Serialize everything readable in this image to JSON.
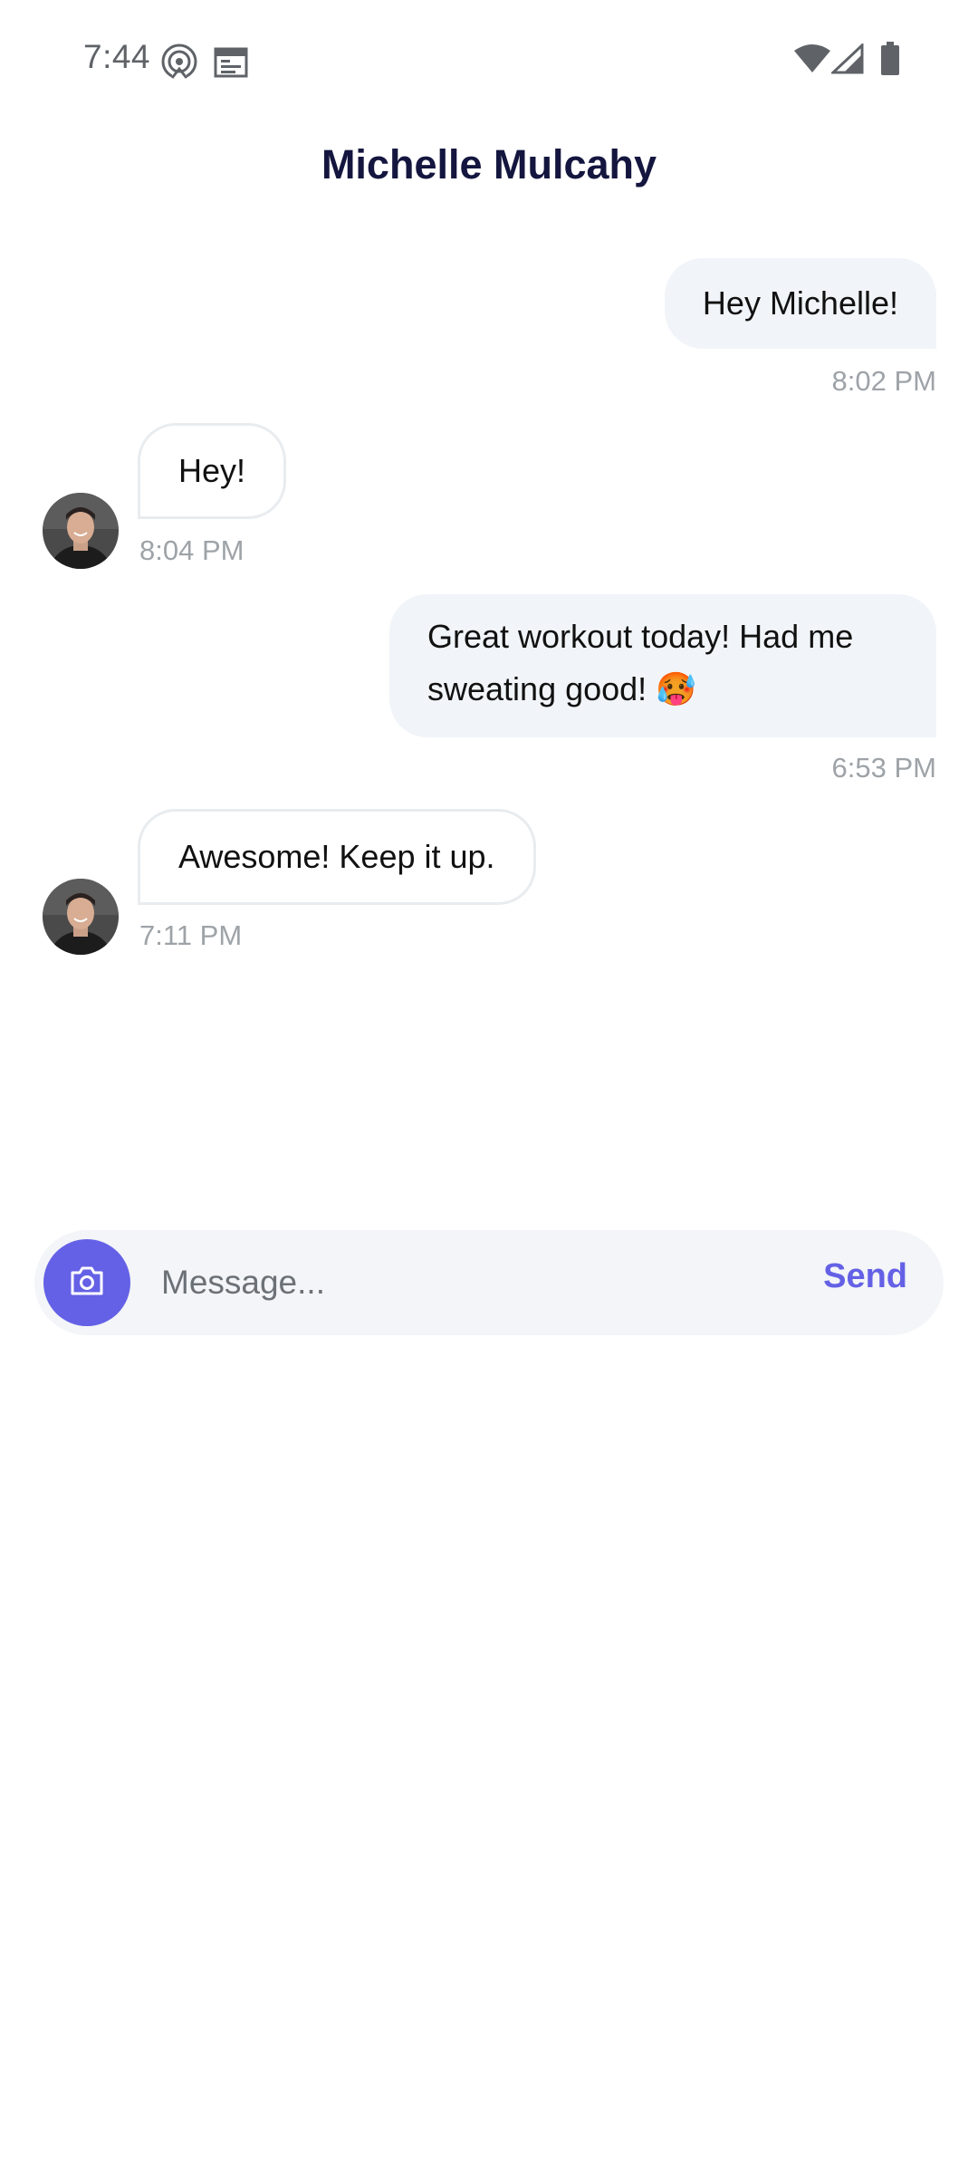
{
  "status_bar": {
    "time": "7:44",
    "left_icons": [
      "podcast-icon",
      "calendar-icon"
    ],
    "right_icons": [
      "wifi-icon",
      "signal-icon",
      "battery-icon"
    ]
  },
  "header": {
    "title": "Michelle Mulcahy"
  },
  "messages": [
    {
      "direction": "outgoing",
      "text": "Hey Michelle!",
      "time": "8:02 PM"
    },
    {
      "direction": "incoming",
      "text": "Hey!",
      "time": "8:04 PM",
      "avatar": "contact-avatar"
    },
    {
      "direction": "outgoing",
      "lines": [
        "Great workout today! Had me",
        "sweating good! 🥵"
      ],
      "time": "6:53 PM"
    },
    {
      "direction": "incoming",
      "text": "Awesome! Keep it up.",
      "time": "7:11 PM",
      "avatar": "contact-avatar"
    }
  ],
  "composer": {
    "placeholder": "Message...",
    "value": "",
    "send_label": "Send",
    "camera_icon": "camera-icon"
  },
  "colors": {
    "accent": "#6461e6",
    "title": "#14163f",
    "outgoing_bubble": "#f1f4f8",
    "incoming_border": "#e9ecef",
    "timestamp": "#9ea3a8"
  }
}
